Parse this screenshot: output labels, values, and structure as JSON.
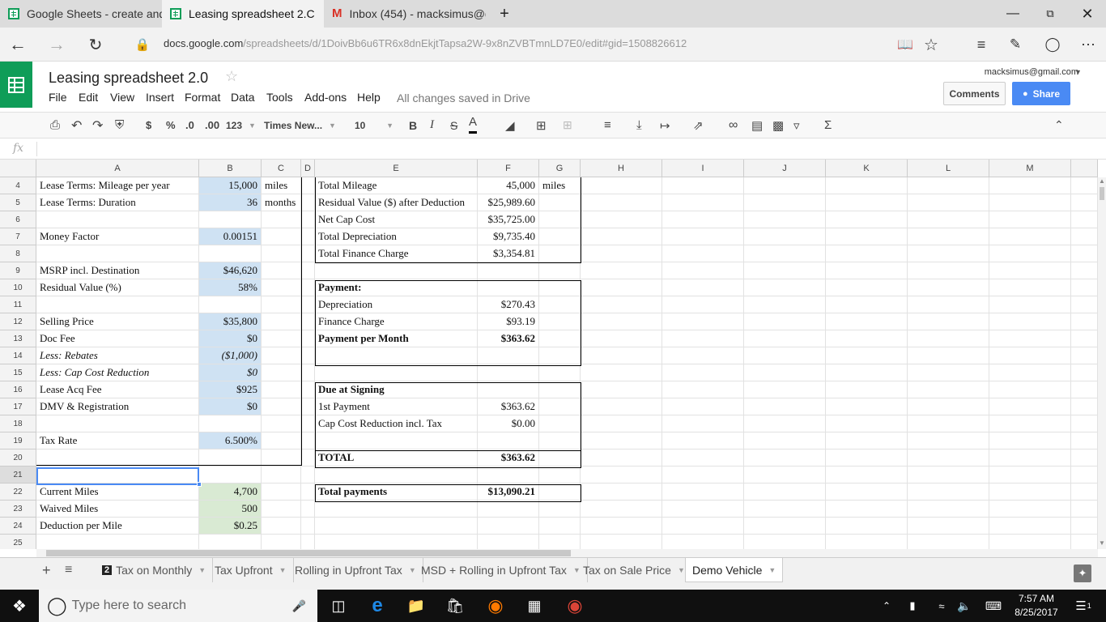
{
  "browser": {
    "tabs": [
      {
        "label": "Google Sheets - create and",
        "icon": "sheets-icon"
      },
      {
        "label": "Leasing spreadsheet 2.C",
        "icon": "sheets-icon"
      },
      {
        "label": "Inbox (454) - macksimus@g",
        "icon": "gmail-icon"
      }
    ],
    "url_domain": "docs.google.com",
    "url_path": "/spreadsheets/d/1DoivBb6u6TR6x8dnEkjtTapsa2W-9x8nZVBTmnLD7E0/edit#gid=1508826612"
  },
  "doc": {
    "title": "Leasing spreadsheet 2.0",
    "menus": [
      "File",
      "Edit",
      "View",
      "Insert",
      "Format",
      "Data",
      "Tools",
      "Add-ons",
      "Help"
    ],
    "saved_status": "All changes saved in Drive",
    "account": "macksimus@gmail.com",
    "comments_label": "Comments",
    "share_label": "Share"
  },
  "toolbar": {
    "currency": "$",
    "percent": "%",
    "dec_dec": ".0",
    "inc_dec": ".00",
    "format_123": "123",
    "font": "Times New...",
    "size": "10",
    "bold": "B",
    "italic": "I",
    "strike": "S",
    "textcolor": "A"
  },
  "formula": {
    "fx": "fx",
    "value": ""
  },
  "columns": [
    "A",
    "B",
    "C",
    "D",
    "E",
    "F",
    "G",
    "H",
    "I",
    "J",
    "K",
    "L",
    "M"
  ],
  "rows": [
    "4",
    "5",
    "6",
    "7",
    "8",
    "9",
    "10",
    "11",
    "12",
    "13",
    "14",
    "15",
    "16",
    "17",
    "18",
    "19",
    "20",
    "21",
    "22",
    "23",
    "24",
    "25"
  ],
  "cells": {
    "a4": "Lease Terms: Mileage per year",
    "b4": "15,000",
    "c4": "miles",
    "a5": "Lease Terms: Duration",
    "b5": "36",
    "c5": "months",
    "a7": "Money Factor",
    "b7": "0.00151",
    "a9": "MSRP incl. Destination",
    "b9": "$46,620",
    "a10": "Residual Value (%)",
    "b10": "58%",
    "a12": "Selling Price",
    "b12": "$35,800",
    "a13": "Doc Fee",
    "b13": "$0",
    "a14": "Less: Rebates",
    "b14": "($1,000)",
    "a15": "Less: Cap Cost Reduction",
    "b15": "$0",
    "a16": "Lease Acq Fee",
    "b16": "$925",
    "a17": "DMV & Registration",
    "b17": "$0",
    "a19": "Tax Rate",
    "b19": "6.500%",
    "a22": "Current Miles",
    "b22": "4,700",
    "a23": "Waived Miles",
    "b23": "500",
    "a24": "Deduction per Mile",
    "b24": "$0.25",
    "e4": "Total Mileage",
    "f4": "45,000",
    "g4": "miles",
    "e5": "Residual Value ($) after Deduction",
    "f5": "$25,989.60",
    "e6": "Net Cap Cost",
    "f6": "$35,725.00",
    "e7": "Total Depreciation",
    "f7": "$9,735.40",
    "e8": "Total Finance Charge",
    "f8": "$3,354.81",
    "e10": "Payment:",
    "e11": "Depreciation",
    "f11": "$270.43",
    "e12": "Finance Charge",
    "f12": "$93.19",
    "e13": "Payment per Month",
    "f13": "$363.62",
    "e16": "Due at Signing",
    "e17": "1st Payment",
    "f17": "$363.62",
    "e18": "Cap Cost Reduction incl. Tax",
    "f18": "$0.00",
    "e20": "TOTAL",
    "f20": "$363.62",
    "e22": "Total payments",
    "f22": "$13,090.21"
  },
  "sheets": [
    {
      "label": "Tax on Monthly",
      "badge": "2"
    },
    {
      "label": "Tax Upfront"
    },
    {
      "label": "Rolling in Upfront Tax"
    },
    {
      "label": "MSD + Rolling in Upfront Tax"
    },
    {
      "label": "Tax on Sale Price"
    },
    {
      "label": "Demo Vehicle",
      "active": true
    }
  ],
  "taskbar": {
    "search_placeholder": "Type here to search",
    "time": "7:57 AM",
    "date": "8/25/2017",
    "notifications": "1"
  }
}
